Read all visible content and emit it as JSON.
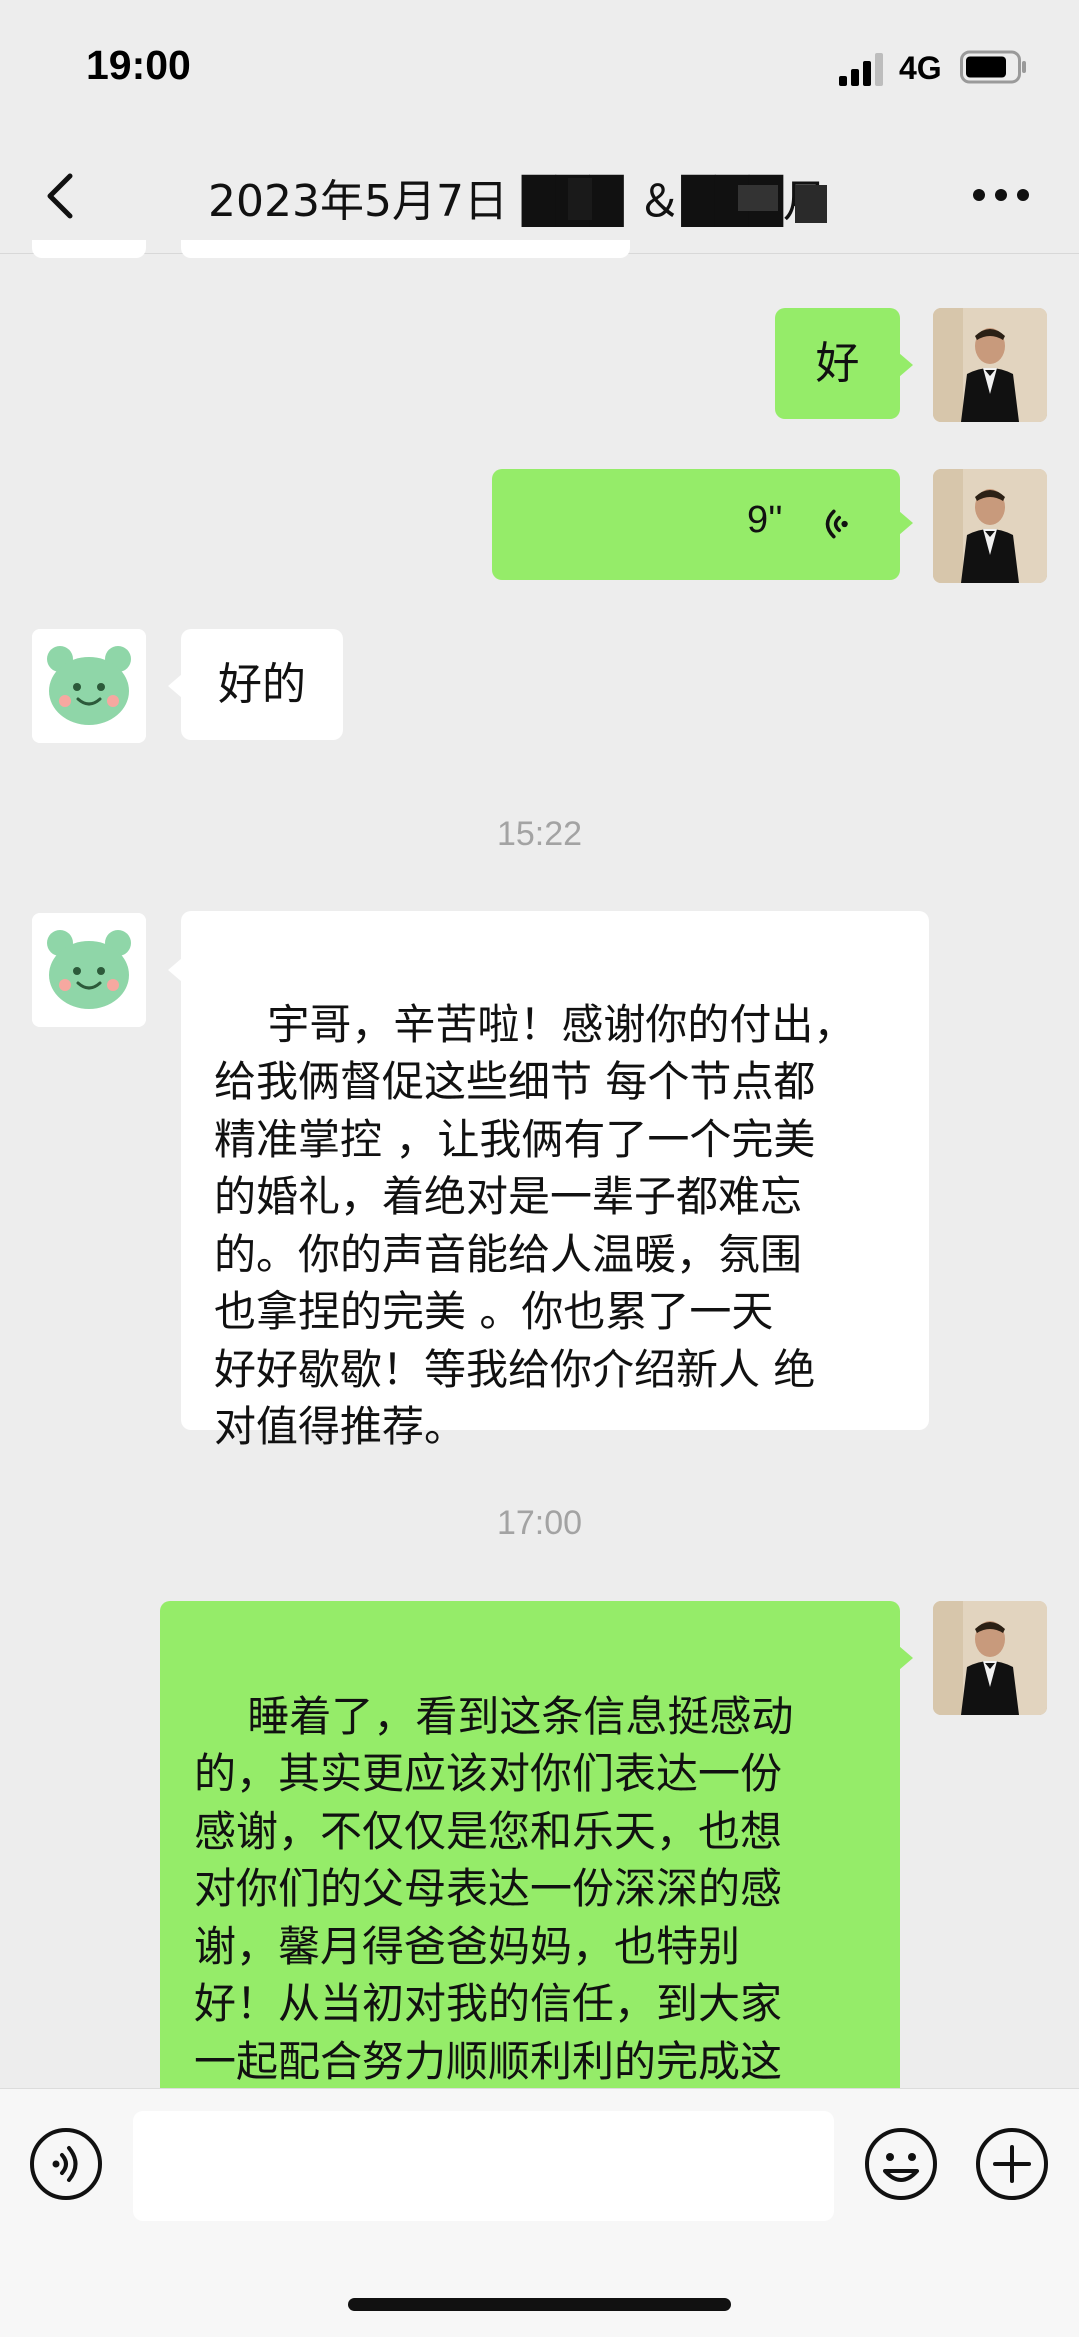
{
  "status_bar": {
    "time": "19:00",
    "network": "4G"
  },
  "nav": {
    "title": "2023年5月7日 ███ ＆███月",
    "back_icon": "chevron-left-icon",
    "more_icon": "more-dots-icon"
  },
  "messages": {
    "msg1": {
      "sender": "me",
      "text": "好"
    },
    "msg2": {
      "sender": "me",
      "type": "voice",
      "duration": "9''"
    },
    "msg3": {
      "sender": "friend",
      "text": "好的"
    },
    "time1": "15:22",
    "msg4": {
      "sender": "friend",
      "text": "宇哥，辛苦啦！感谢你的付出，\n给我俩督促这些细节 每个节点都\n精准掌控 ，让我俩有了一个完美\n的婚礼，着绝对是一辈子都难忘\n的。你的声音能给人温暖，氛围\n也拿捏的完美 。你也累了一天\n好好歇歇！等我给你介绍新人 绝\n对值得推荐。"
    },
    "time2": "17:00",
    "msg5": {
      "sender": "me",
      "text": "睡着了，看到这条信息挺感动\n的，其实更应该对你们表达一份\n感谢，不仅仅是您和乐天，也想\n对你们的父母表达一份深深的感\n谢，馨月得爸爸妈妈，也特别\n好！从当初对我的信任，到大家\n一起配合努力顺顺利利的完成这\n场婚礼，我相信是因为善因，所"
    }
  },
  "input_bar": {
    "value": "",
    "voice_icon": "voice-input-icon",
    "emoji_icon": "emoji-icon",
    "plus_icon": "plus-icon"
  }
}
